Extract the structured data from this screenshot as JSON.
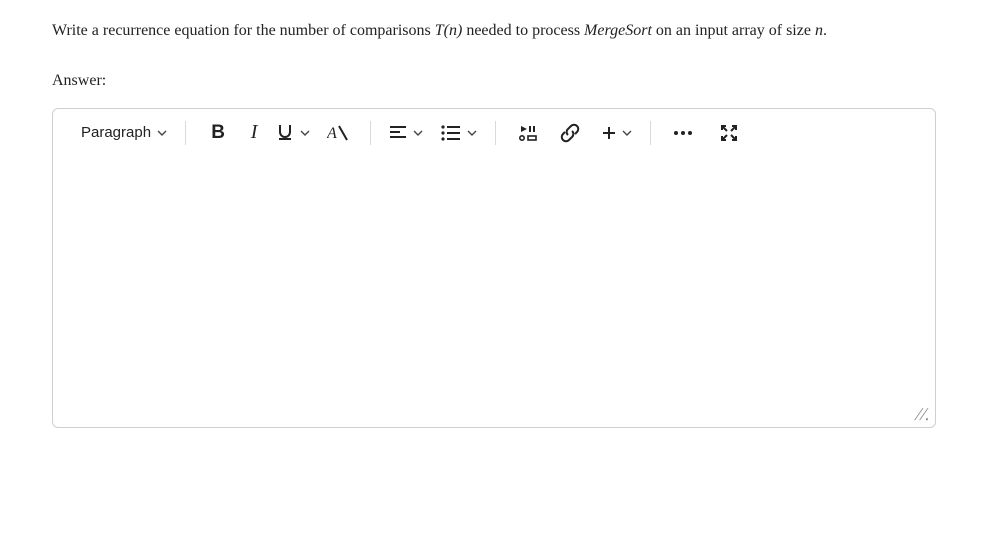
{
  "question": {
    "pre": "Write a recurrence equation for the number of comparisons ",
    "tn": "T(n)",
    "mid": " needed to process ",
    "ms": "MergeSort",
    "post1": " on an input array of size ",
    "nvar": "n",
    "post2": "."
  },
  "answer_label": "Answer:",
  "toolbar": {
    "paragraph_label": "Paragraph",
    "bold_glyph": "B",
    "italic_glyph": "I",
    "resize_glyph": "//."
  },
  "icons": {
    "paragraph": "paragraph-dropdown",
    "bold": "bold-icon",
    "italic": "italic-icon",
    "underline": "underline-icon",
    "clearfmt": "clear-format-icon",
    "align": "align-left-icon",
    "list": "list-icon",
    "media": "media-player-icon",
    "link": "link-icon",
    "plus": "plus-icon",
    "more": "more-dots-icon",
    "fullscreen": "fullscreen-icon"
  },
  "editor_content": ""
}
